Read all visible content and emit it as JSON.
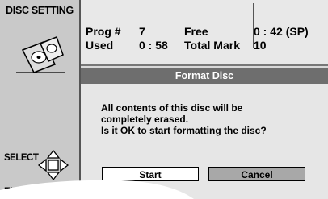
{
  "sidebar": {
    "title": "DISC SETTING",
    "icon": "discs-icon",
    "select_label": "SELECT",
    "enter_label": "ENTER"
  },
  "info": {
    "prog_label": "Prog #",
    "prog_value": "7",
    "used_label": "Used",
    "used_value": "0 : 58",
    "free_label": "Free",
    "free_value": "0 : 42 (SP)",
    "total_mark_label": "Total Mark",
    "total_mark_value": "10"
  },
  "dialog": {
    "title": "Format Disc",
    "line1": "All contents of this disc will be",
    "line2": "completely erased.",
    "line3": "Is it OK to start formatting the disc?",
    "start_label": "Start",
    "cancel_label": "Cancel"
  }
}
